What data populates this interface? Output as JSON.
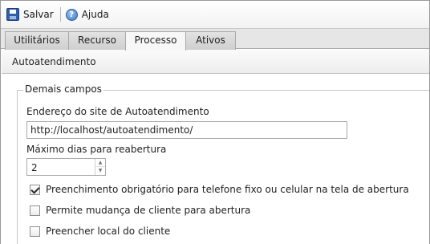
{
  "toolbar": {
    "save_label": "Salvar",
    "help_label": "Ajuda",
    "save_icon": "floppy-disk-icon",
    "help_icon": "help-icon"
  },
  "tabs": [
    {
      "label": "Utilitários",
      "active": false
    },
    {
      "label": "Recurso",
      "active": false
    },
    {
      "label": "Processo",
      "active": true
    },
    {
      "label": "Ativos",
      "active": false
    }
  ],
  "panel": {
    "title": "Autoatendimento",
    "fieldset_legend": "Demais campos",
    "site_label": "Endereço do site de Autoatendimento",
    "site_value": "http://localhost/autoatendimento/",
    "max_days_label": "Máximo dias para reabertura",
    "max_days_value": "2",
    "checkboxes": [
      {
        "label": "Preenchimento obrigatório para telefone fixo ou celular na tela de abertura",
        "checked": true
      },
      {
        "label": "Permite mudança de cliente para abertura",
        "checked": false
      },
      {
        "label": "Preencher local do cliente",
        "checked": false
      }
    ]
  }
}
